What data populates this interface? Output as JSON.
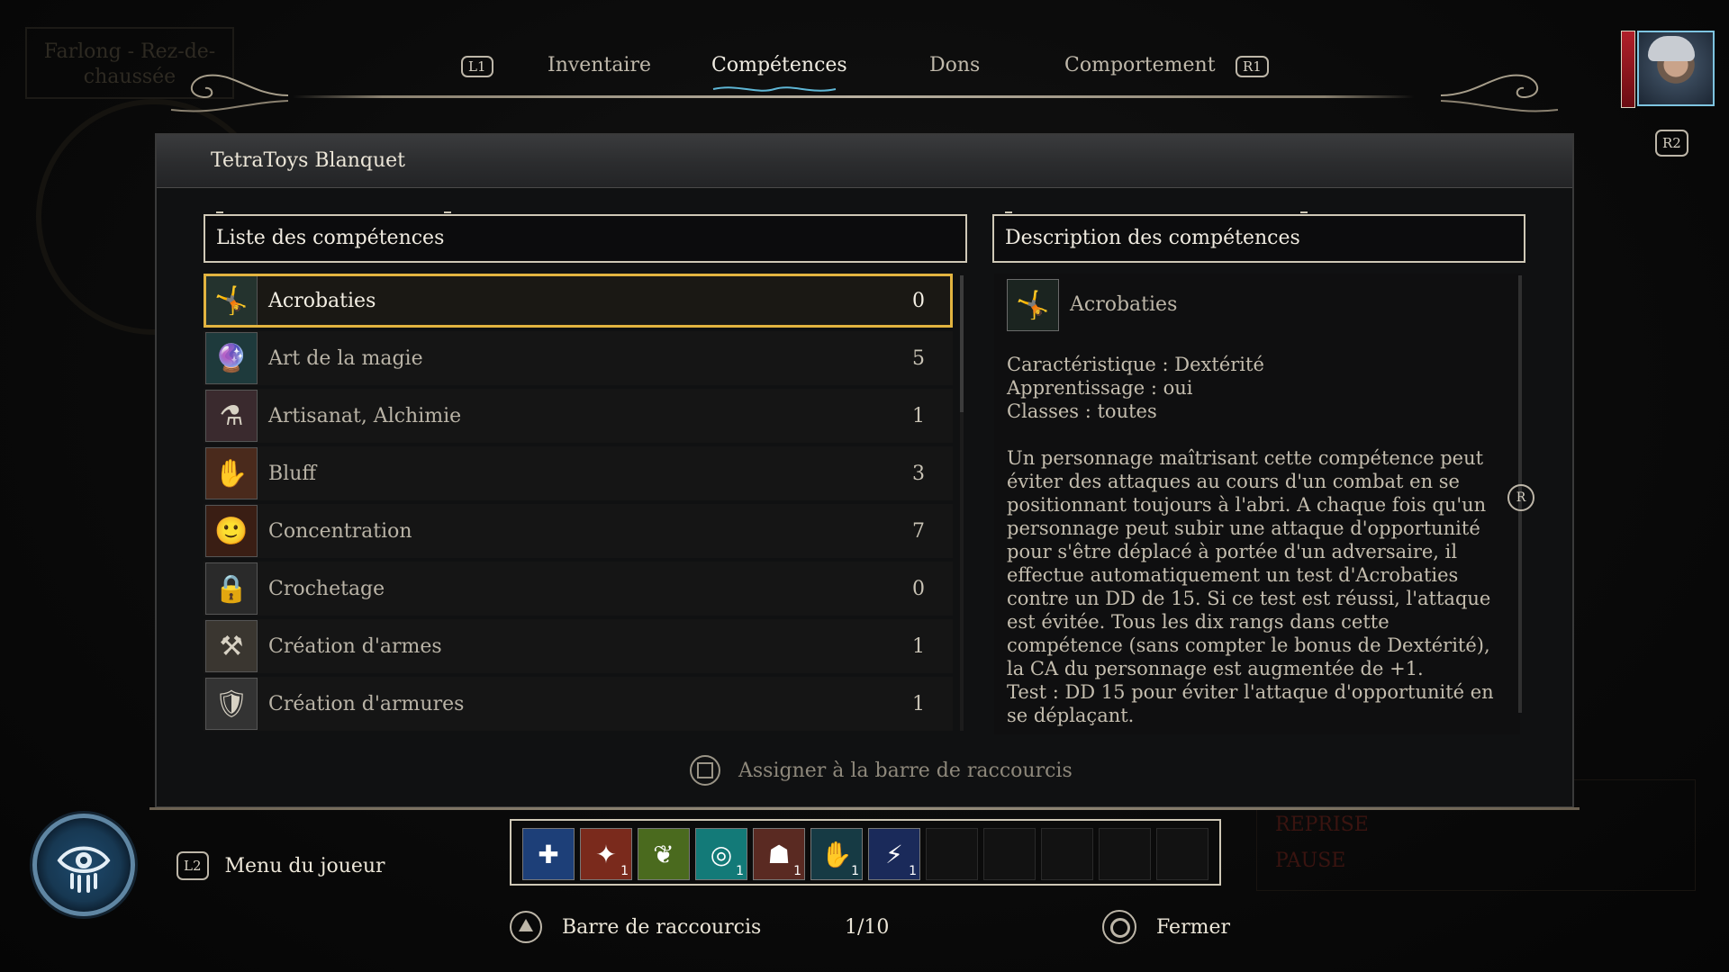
{
  "background": {
    "location": "Farlong - Rez-de-chaussée",
    "status_lines": [
      "REPRISE",
      "PAUSE"
    ]
  },
  "tabs": {
    "prev_hint": "L1",
    "next_hint": "R1",
    "items": [
      {
        "label": "Inventaire",
        "active": false
      },
      {
        "label": "Compétences",
        "active": true
      },
      {
        "label": "Dons",
        "active": false
      },
      {
        "label": "Comportement",
        "active": false
      }
    ]
  },
  "portrait_hint": "R2",
  "panel": {
    "character_name": "TetraToys Blanquet",
    "list_header": "Liste des compétences",
    "desc_header": "Description des compétences"
  },
  "skills": [
    {
      "name": "Acrobaties",
      "rank": "0",
      "icon": "acrobatics-icon",
      "glyph": "🤸",
      "bg": "#24332e",
      "selected": true
    },
    {
      "name": "Art de la magie",
      "rank": "5",
      "icon": "spellcraft-icon",
      "glyph": "🔮",
      "bg": "#1e3a3c",
      "selected": false
    },
    {
      "name": "Artisanat, Alchimie",
      "rank": "1",
      "icon": "alchemy-icon",
      "glyph": "⚗",
      "bg": "#3a2a2e",
      "selected": false
    },
    {
      "name": "Bluff",
      "rank": "3",
      "icon": "bluff-icon",
      "glyph": "✋",
      "bg": "#4a2a1c",
      "selected": false
    },
    {
      "name": "Concentration",
      "rank": "7",
      "icon": "concentration-icon",
      "glyph": "🙂",
      "bg": "#3a1e14",
      "selected": false
    },
    {
      "name": "Crochetage",
      "rank": "0",
      "icon": "lockpick-icon",
      "glyph": "🔒",
      "bg": "#2a2a2a",
      "selected": false
    },
    {
      "name": "Création d'armes",
      "rank": "1",
      "icon": "weaponcraft-icon",
      "glyph": "⚒",
      "bg": "#3a3630",
      "selected": false
    },
    {
      "name": "Création d'armures",
      "rank": "1",
      "icon": "armorcraft-icon",
      "glyph": "🛡",
      "bg": "#333333",
      "selected": false
    }
  ],
  "description": {
    "name": "Acrobaties",
    "lines": [
      "Caractéristique : Dextérité",
      "Apprentissage : oui",
      "Classes : toutes"
    ],
    "body": "Un personnage maîtrisant cette compétence peut éviter des attaques au cours d'un combat en se positionnant toujours à l'abri. A chaque fois qu'un personnage peut subir une attaque d'opportunité pour s'être déplacé à portée d'un adversaire, il effectue automatiquement un test d'Acrobaties contre un DD de 15. Si ce test est réussi, l'attaque est évitée. Tous les dix rangs dans cette compétence (sans compter le bonus de Dextérité), la CA du personnage est augmentée de +1.",
    "test": "Test : DD 15 pour éviter l'attaque d'opportunité en se déplaçant.",
    "scroll_hint": "R"
  },
  "assign_label": "Assigner à la barre de raccourcis",
  "player_menu": {
    "hint": "L2",
    "label": "Menu du joueur"
  },
  "hotbar": {
    "slots": [
      {
        "icon": "heal-icon",
        "glyph": "✚",
        "bg": "#1d3f78",
        "count": ""
      },
      {
        "icon": "spell-fire-icon",
        "glyph": "✦",
        "bg": "#7a2a1c",
        "count": "1"
      },
      {
        "icon": "spell-nature-icon",
        "glyph": "❦",
        "bg": "#4a6a1e",
        "count": ""
      },
      {
        "icon": "spell-vortex-icon",
        "glyph": "◎",
        "bg": "#137a78",
        "count": "1"
      },
      {
        "icon": "spell-figure-icon",
        "glyph": "☗",
        "bg": "#5a2a22",
        "count": "1"
      },
      {
        "icon": "spell-hand-icon",
        "glyph": "✋",
        "bg": "#163a44",
        "count": "1"
      },
      {
        "icon": "spell-lightning-icon",
        "glyph": "⚡",
        "bg": "#1a2a5a",
        "count": "1"
      },
      {
        "icon": "",
        "glyph": "",
        "bg": "",
        "count": ""
      },
      {
        "icon": "",
        "glyph": "",
        "bg": "",
        "count": ""
      },
      {
        "icon": "",
        "glyph": "",
        "bg": "",
        "count": ""
      },
      {
        "icon": "",
        "glyph": "",
        "bg": "",
        "count": ""
      },
      {
        "icon": "",
        "glyph": "",
        "bg": "",
        "count": ""
      }
    ]
  },
  "hotbar_nav": {
    "label": "Barre de raccourcis",
    "page": "1/10"
  },
  "close_label": "Fermer",
  "colors": {
    "selected_outline": "#e2b440",
    "accent_blue": "#5f86a3"
  }
}
